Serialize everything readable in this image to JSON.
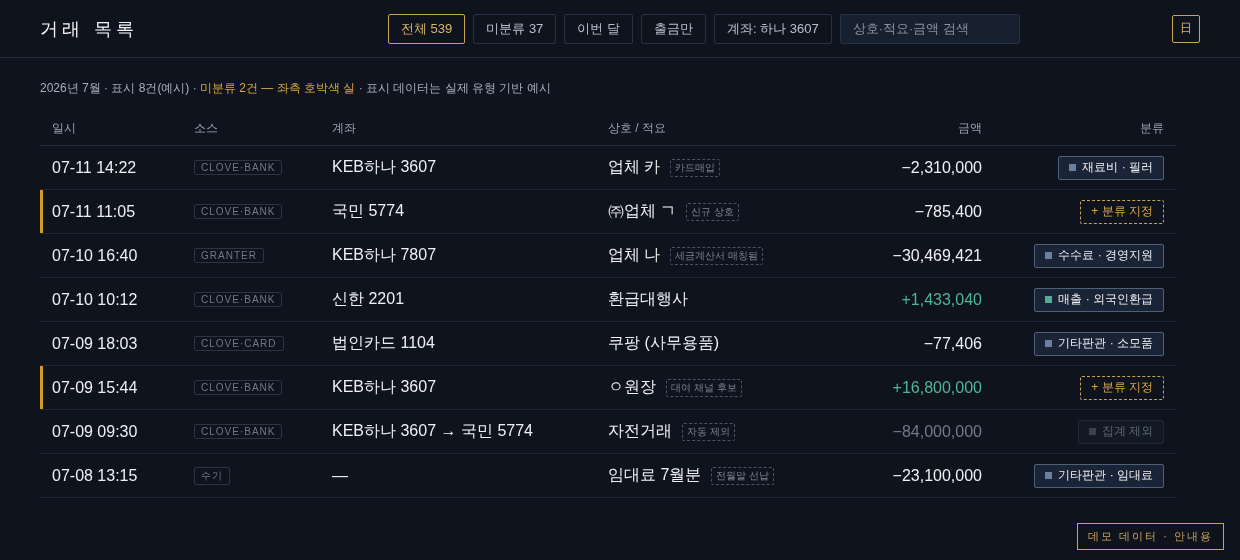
{
  "header": {
    "title": "거래 목록",
    "filters": [
      {
        "label": "전체 539",
        "selected": true
      },
      {
        "label": "미분류 37",
        "selected": false
      },
      {
        "label": "이번 달",
        "selected": false
      },
      {
        "label": "출금만",
        "selected": false
      },
      {
        "label": "계좌: 하나 3607",
        "selected": false
      }
    ],
    "search": {
      "placeholder": "상호·적요·금액 검색"
    },
    "calendar_button": "日"
  },
  "summary": {
    "lead": "2026년 7월 · 표시 8건(예시) · ",
    "highlight": "미분류 2건 — 좌측 호박색 실",
    "tail": " · 표시 데이터는 실제 유형 기반 예시"
  },
  "table": {
    "columns": [
      "일시",
      "소스",
      "계좌",
      "상호 / 적요",
      "금액",
      "분류"
    ],
    "rows": [
      {
        "flagged": false,
        "time": "07-11 14:22",
        "source": "CLOVE·BANK",
        "account": "KEB하나 3607",
        "merchant": "업체 카",
        "tag": "카드매입",
        "amount": {
          "text": "−2,310,000",
          "kind": "out"
        },
        "category": {
          "kind": "assigned",
          "label": "재료비 · 필러",
          "color": "#6b7f9e"
        }
      },
      {
        "flagged": true,
        "time": "07-11 11:05",
        "source": "CLOVE·BANK",
        "account": "국민 5774",
        "merchant": "㈜업체 ㄱ",
        "tag": "신규 상호",
        "amount": {
          "text": "−785,400",
          "kind": "out"
        },
        "category": {
          "kind": "unassigned",
          "label": "+ 분류 지정"
        }
      },
      {
        "flagged": false,
        "time": "07-10 16:40",
        "source": "GRANTER",
        "account": "KEB하나 7807",
        "merchant": "업체 나",
        "tag": "세금계산서 매칭됨",
        "amount": {
          "text": "−30,469,421",
          "kind": "out"
        },
        "category": {
          "kind": "assigned",
          "label": "수수료 · 경영지원",
          "color": "#6b7f9e"
        }
      },
      {
        "flagged": false,
        "time": "07-10 10:12",
        "source": "CLOVE·BANK",
        "account": "신한 2201",
        "merchant": "환급대행사",
        "amount": {
          "text": "+1,433,040",
          "kind": "in"
        },
        "category": {
          "kind": "assigned",
          "label": "매출 · 외국인환급",
          "color": "#4fae92"
        }
      },
      {
        "flagged": false,
        "time": "07-09 18:03",
        "source": "CLOVE·CARD",
        "account": "법인카드 1104",
        "merchant": "쿠팡 (사무용품)",
        "amount": {
          "text": "−77,406",
          "kind": "out"
        },
        "category": {
          "kind": "assigned",
          "label": "기타판관 · 소모품",
          "color": "#6b7f9e"
        }
      },
      {
        "flagged": true,
        "time": "07-09 15:44",
        "source": "CLOVE·BANK",
        "account": "KEB하나 3607",
        "merchant": "ㅇ원장",
        "tag": "대여 채널 후보",
        "amount": {
          "text": "+16,800,000",
          "kind": "in"
        },
        "category": {
          "kind": "unassigned",
          "label": "+ 분류 지정"
        }
      },
      {
        "flagged": false,
        "time": "07-09 09:30",
        "source": "CLOVE·BANK",
        "account": "KEB하나 3607 → 국민 5774",
        "merchant": "자전거래",
        "tag": "자동 제외",
        "amount": {
          "text": "−84,000,000",
          "kind": "excluded"
        },
        "category": {
          "kind": "excluded",
          "label": "집계 제외",
          "color": "#3a4150"
        }
      },
      {
        "flagged": false,
        "time": "07-08 13:15",
        "source": "수기",
        "account": "—",
        "merchant": "임대료 7월분",
        "tag": "전월말 선납",
        "amount": {
          "text": "−23,100,000",
          "kind": "out"
        },
        "category": {
          "kind": "assigned",
          "label": "기타판관 · 임대료",
          "color": "#6b7f9e"
        }
      }
    ]
  },
  "footer_badge": "데모 데이터 · 안내용"
}
